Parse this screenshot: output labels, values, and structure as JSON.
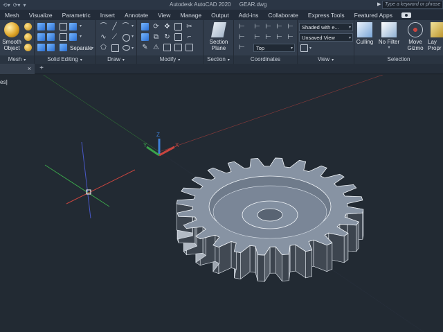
{
  "titlebar": {
    "app_title": "Autodesk AutoCAD 2020",
    "file_name": "GEAR.dwg",
    "search_placeholder": "Type a keyword or phrase",
    "qat_icons": [
      "undo-icon",
      "redo-icon",
      "customize-icon"
    ]
  },
  "tabs": [
    {
      "label": "Mesh"
    },
    {
      "label": "Visualize"
    },
    {
      "label": "Parametric"
    },
    {
      "label": "Insert"
    },
    {
      "label": "Annotate"
    },
    {
      "label": "View"
    },
    {
      "label": "Manage"
    },
    {
      "label": "Output"
    },
    {
      "label": "Add-ins"
    },
    {
      "label": "Collaborate"
    },
    {
      "label": "Express Tools"
    },
    {
      "label": "Featured Apps"
    }
  ],
  "ribbon": {
    "mesh": {
      "panel_label": "Mesh",
      "smooth_object": "Smooth Object",
      "smooth_line1": "Smooth",
      "smooth_line2": "Object"
    },
    "solid_editing": {
      "panel_label": "Solid Editing",
      "separate": "Separate"
    },
    "draw": {
      "panel_label": "Draw"
    },
    "modify": {
      "panel_label": "Modify"
    },
    "section": {
      "panel_label": "Section",
      "section_plane_line1": "Section",
      "section_plane_line2": "Plane"
    },
    "coordinates": {
      "panel_label": "Coordinates",
      "ucs_value": "Top"
    },
    "view": {
      "panel_label": "View",
      "visual_style": "Shaded with e...",
      "saved_view": "Unsaved View"
    },
    "selection": {
      "panel_label": "Selection",
      "culling": "Culling",
      "filter_line1": "No Filter",
      "gizmo_line1": "Move",
      "gizmo_line2": "Gizmo",
      "layers_line1": "Lay",
      "layers_line2": "Propr"
    }
  },
  "doctabs": {
    "close": "×",
    "add": "+"
  },
  "viewport": {
    "label": "es]"
  },
  "colors": {
    "accent": "#3d7fd6",
    "axis_x": "#c8453f",
    "axis_y": "#3aa34a",
    "axis_z": "#3d7fd6",
    "viewport_bg": "#222a33"
  }
}
